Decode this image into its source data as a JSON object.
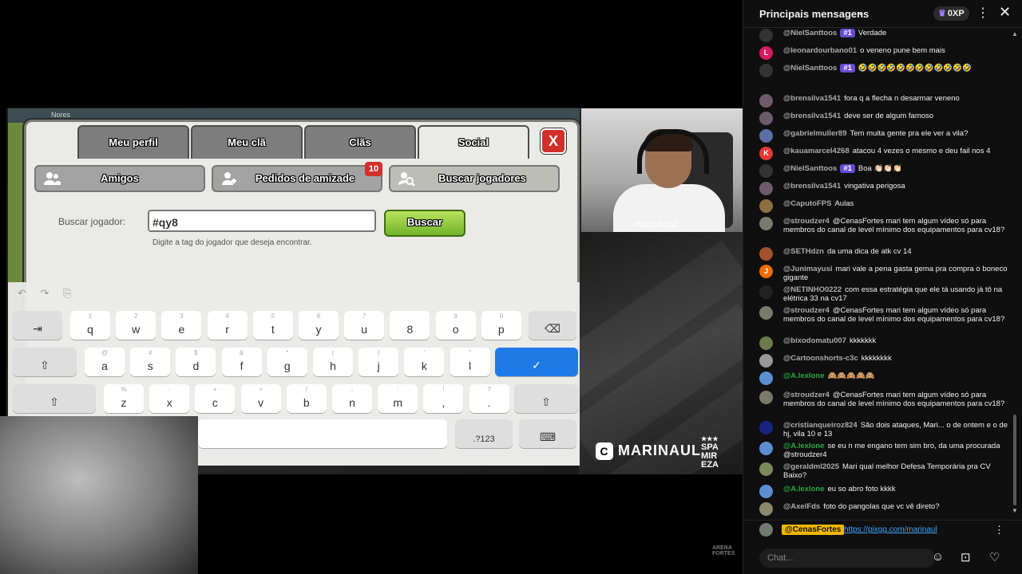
{
  "game": {
    "panel_label": "Nores",
    "tabs": [
      {
        "label": "Meu perfil"
      },
      {
        "label": "Meu clã"
      },
      {
        "label": "Clãs"
      },
      {
        "label": "Social"
      }
    ],
    "close_label": "X",
    "sub_buttons": {
      "friends": "Amigos",
      "friend_requests": "Pedidos de amizade",
      "friend_requests_badge": "10",
      "search_players": "Buscar jogadores"
    },
    "search_label": "Buscar jogador:",
    "search_value": "#qy8",
    "search_button": "Buscar",
    "search_hint": "Digite a tag do jogador que deseja encontrar."
  },
  "keyboard": {
    "tools": [
      "↶",
      "↷",
      "⎘"
    ],
    "row1": [
      {
        "main": "q",
        "alt": "1"
      },
      {
        "main": "w",
        "alt": "2"
      },
      {
        "main": "e",
        "alt": "3"
      },
      {
        "main": "r",
        "alt": "4"
      },
      {
        "main": "t",
        "alt": "5"
      },
      {
        "main": "y",
        "alt": "6"
      },
      {
        "main": "u",
        "alt": "7"
      },
      {
        "main": "8",
        "alt": ""
      },
      {
        "main": "o",
        "alt": "9"
      },
      {
        "main": "p",
        "alt": "0"
      }
    ],
    "row2": [
      {
        "main": "a",
        "alt": "@"
      },
      {
        "main": "s",
        "alt": "#"
      },
      {
        "main": "d",
        "alt": "$"
      },
      {
        "main": "f",
        "alt": "&"
      },
      {
        "main": "g",
        "alt": "*"
      },
      {
        "main": "h",
        "alt": "("
      },
      {
        "main": "j",
        "alt": ")"
      },
      {
        "main": "k",
        "alt": "'"
      },
      {
        "main": "l",
        "alt": "\""
      }
    ],
    "row3": [
      {
        "main": "z",
        "alt": "%"
      },
      {
        "main": "x",
        "alt": "-"
      },
      {
        "main": "c",
        "alt": "+"
      },
      {
        "main": "v",
        "alt": "="
      },
      {
        "main": "b",
        "alt": "/"
      },
      {
        "main": "n",
        "alt": ";"
      },
      {
        "main": "m",
        "alt": ":"
      },
      {
        "main": ",",
        "alt": "!"
      },
      {
        "main": ".",
        "alt": "?"
      }
    ],
    "tab_key": "⇥",
    "backspace_key": "⌫",
    "shift_key": "⇧",
    "enter_key": "✓",
    "numbers_key": ".?123",
    "hide_key": "⌨"
  },
  "stream": {
    "webcam_signature": "marinaul",
    "brand_name": "MARINAUL",
    "brand_icon": "C",
    "badge_lines": [
      "★★★",
      "SPA",
      "MIR",
      "EZA"
    ],
    "small_logo": [
      "ARENA",
      "FORTES"
    ]
  },
  "chat": {
    "title": "Principais mensagens",
    "xp": "0XP",
    "messages": [
      {
        "author": "@NielSanttoos",
        "badge": "#1",
        "text": "Verdade",
        "avatar_color": "#333",
        "initial": ""
      },
      {
        "author": "@leonardourbano01",
        "badge": "",
        "text": "o veneno pune bem mais",
        "avatar_color": "#d81b60",
        "initial": "L"
      },
      {
        "author": "@NielSanttoos",
        "badge": "#1",
        "text": "🤣🤣🤣🤣🤣🤣🤣🤣🤣🤣🤣🤣",
        "avatar_color": "#333",
        "initial": ""
      },
      {
        "author": "@brensilva1541",
        "badge": "",
        "text": "fora q a flecha n desarmar veneno",
        "avatar_color": "#6b5b6b",
        "initial": ""
      },
      {
        "author": "@brensilva1541",
        "badge": "",
        "text": "deve ser de algum famoso",
        "avatar_color": "#6b5b6b",
        "initial": ""
      },
      {
        "author": "@gabrielmuller89",
        "badge": "",
        "text": "Tem muita gente pra ele ver a vila?",
        "avatar_color": "#5b6fa1",
        "initial": ""
      },
      {
        "author": "@kauamarcel4268",
        "badge": "",
        "text": "atacou 4 vezes o mesmo e deu fail nos 4",
        "avatar_color": "#e53935",
        "initial": "K"
      },
      {
        "author": "@NielSanttoos",
        "badge": "#1",
        "text": "Boa 👏🏻👏🏻👏🏻",
        "avatar_color": "#333",
        "initial": ""
      },
      {
        "author": "@brensilva1541",
        "badge": "",
        "text": "vingativa perigosa",
        "avatar_color": "#6b5b6b",
        "initial": ""
      },
      {
        "author": "@CaputoFPS",
        "badge": "",
        "text": "Aulas",
        "avatar_color": "#8d6e43",
        "initial": ""
      },
      {
        "author": "@stroudzer4",
        "badge": "",
        "text": "@CenasFortes mari tem algum vídeo só para membros do canal de level mínimo dos equipamentos para cv18?",
        "avatar_color": "#7a7a6a",
        "initial": ""
      },
      {
        "author": "@SETHdzn",
        "badge": "",
        "text": "da uma dica de atk cv 14",
        "avatar_color": "#a0522d",
        "initial": ""
      },
      {
        "author": "@Junimayusi",
        "badge": "",
        "text": "mari vale a pena gasta gema pra compra o boneco gigante",
        "avatar_color": "#ef6c00",
        "initial": "J"
      },
      {
        "author": "@NETINHO0222",
        "badge": "",
        "text": "com essa estratégia que ele tá usando já tô na elétrica 33 na cv17",
        "avatar_color": "#222",
        "initial": ""
      },
      {
        "author": "@stroudzer4",
        "badge": "",
        "text": "@CenasFortes mari tem algum vídeo só para membros do canal de level mínimo dos equipamentos para cv18?",
        "avatar_color": "#7a7a6a",
        "initial": ""
      },
      {
        "author": "@bixodomatu007",
        "badge": "",
        "text": "kkkkkkk",
        "avatar_color": "#6a7a4a",
        "initial": ""
      },
      {
        "author": "@Cartoonshorts-c3c",
        "badge": "",
        "text": "kkkkkkkk",
        "avatar_color": "#999",
        "initial": ""
      },
      {
        "author": "@A.lexlone",
        "badge": "",
        "text": "🙈🙈🙈🙈🙈",
        "avatar_color": "#5b8fd1",
        "initial": "",
        "mod": true
      },
      {
        "author": "@stroudzer4",
        "badge": "",
        "text": "@CenasFortes mari tem algum vídeo só para membros do canal de level mínimo dos equipamentos para cv18?",
        "avatar_color": "#7a7a6a",
        "initial": ""
      },
      {
        "author": "@cristianqueiroz824",
        "badge": "",
        "text": "São dois ataques, Mari... o de ontem e o de hj, vila 10 e 13",
        "avatar_color": "#1a237e",
        "initial": ""
      },
      {
        "author": "@A.lexlone",
        "badge": "",
        "text": "se eu n me engano tem sim bro, da uma procurada @stroudzer4",
        "avatar_color": "#5b8fd1",
        "initial": "",
        "mod": true
      },
      {
        "author": "@geraldml2025",
        "badge": "",
        "text": "Mari qual melhor Defesa Temporária pra CV Baixo?",
        "avatar_color": "#7b8a5b",
        "initial": ""
      },
      {
        "author": "@A.lexlone",
        "badge": "",
        "text": "eu so abro foto kkkk",
        "avatar_color": "#5b8fd1",
        "initial": "",
        "mod": true
      },
      {
        "author": "@AxelFds",
        "badge": "",
        "text": "foto do pangolas que vc vê direto?",
        "avatar_color": "#8a8a6a",
        "initial": ""
      }
    ],
    "pinned": {
      "author": "@CenasFortes",
      "link": "https://pixgg.com/marinaul"
    },
    "input_placeholder": "Chat..."
  }
}
